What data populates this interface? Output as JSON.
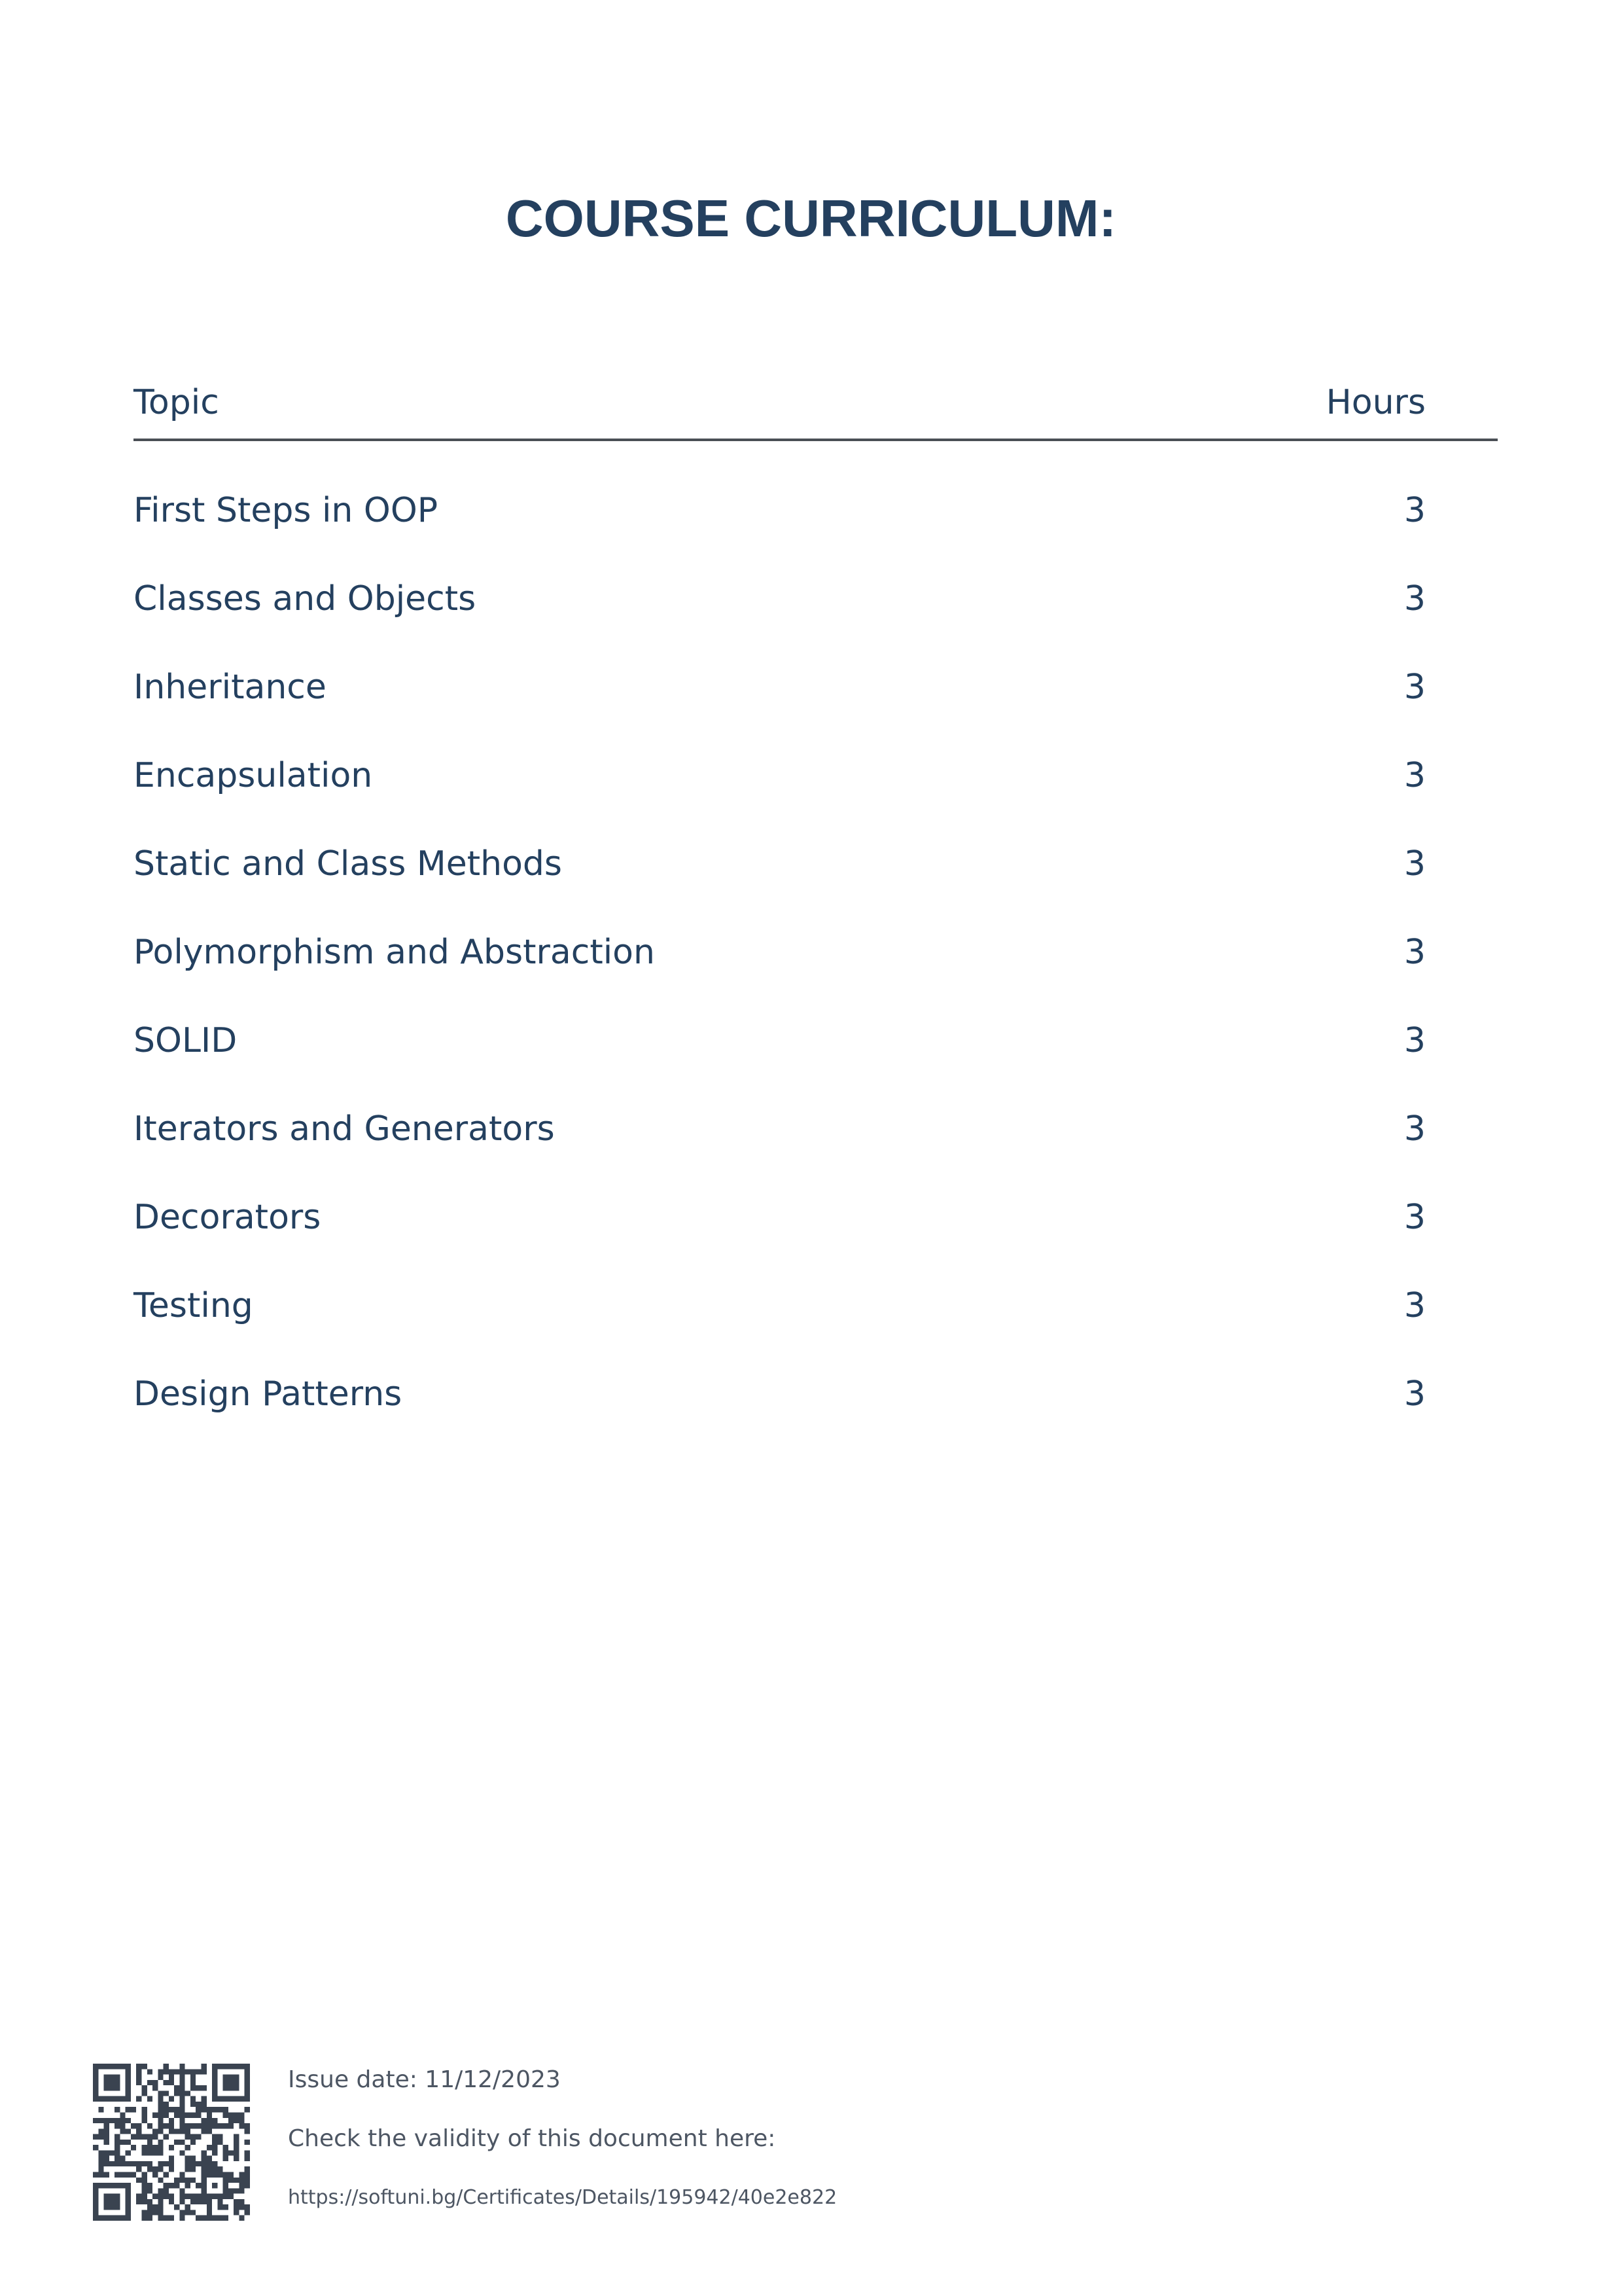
{
  "document": {
    "title": "COURSE CURRICULUM:"
  },
  "table": {
    "headers": {
      "topic": "Topic",
      "hours": "Hours"
    },
    "rows": [
      {
        "topic": "First Steps in OOP",
        "hours": "3"
      },
      {
        "topic": "Classes and Objects",
        "hours": "3"
      },
      {
        "topic": "Inheritance",
        "hours": "3"
      },
      {
        "topic": "Encapsulation",
        "hours": "3"
      },
      {
        "topic": "Static and Class Methods",
        "hours": "3"
      },
      {
        "topic": "Polymorphism and Abstraction",
        "hours": "3"
      },
      {
        "topic": "SOLID",
        "hours": "3"
      },
      {
        "topic": "Iterators and Generators",
        "hours": "3"
      },
      {
        "topic": "Decorators",
        "hours": "3"
      },
      {
        "topic": "Testing",
        "hours": "3"
      },
      {
        "topic": "Design Patterns",
        "hours": "3"
      }
    ]
  },
  "footer": {
    "issue_date": "Issue date: 11/12/2023",
    "validity_text": "Check the validity of this document here:",
    "url": "https://softuni.bg/Certificates/Details/195942/40e2e822"
  },
  "colors": {
    "primary_text": "#24405f",
    "rule": "#4a4f55",
    "footer_text": "#4d5663",
    "qr": "#3a4350"
  },
  "icons": {
    "qr": "qr-code-icon"
  }
}
